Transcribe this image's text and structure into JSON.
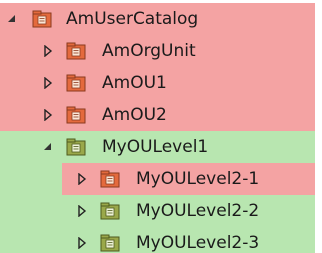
{
  "colors": {
    "error_row": "#f4a3a3",
    "ok_row": "#b8e6b0",
    "folder_red": "#e46a3d",
    "folder_green": "#9aa84a"
  },
  "tree": {
    "root": {
      "label": "AmUserCatalog",
      "expanded": true,
      "icon": "folder-red-icon"
    },
    "items": [
      {
        "label": "AmOrgUnit",
        "expanded": false,
        "icon": "folder-red-icon"
      },
      {
        "label": "AmOU1",
        "expanded": false,
        "icon": "folder-red-icon"
      },
      {
        "label": "AmOU2",
        "expanded": false,
        "icon": "folder-red-icon"
      },
      {
        "label": "MyOULevel1",
        "expanded": true,
        "icon": "folder-green-icon"
      },
      {
        "label": "MyOULevel2-1",
        "expanded": false,
        "icon": "folder-red-icon"
      },
      {
        "label": "MyOULevel2-2",
        "expanded": false,
        "icon": "folder-green-icon"
      },
      {
        "label": "MyOULevel2-3",
        "expanded": false,
        "icon": "folder-green-icon"
      }
    ]
  }
}
